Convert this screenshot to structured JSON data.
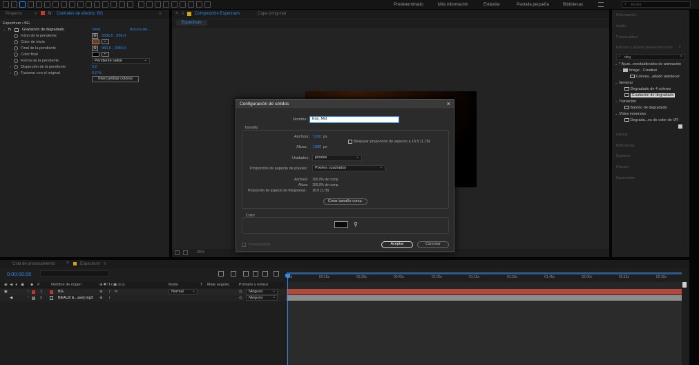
{
  "menubar": {
    "workspaces": [
      "Predeterminado",
      "Más información",
      "Estándar",
      "Pantalla pequeña",
      "Bibliotecas"
    ],
    "search_placeholder": "Ayuda"
  },
  "left_panel": {
    "tabs": [
      "Proyecto",
      "Controles de efectos: BG"
    ],
    "header": "Espectrum • BG",
    "effect_name": "Gradación de degradado",
    "reset_label": "Rest",
    "about_label": "Acerca de...",
    "properties": [
      {
        "label": "Inicio de la pendiente",
        "value": "3332,0 , 856,0"
      },
      {
        "label": "Color de inicio",
        "value": ""
      },
      {
        "label": "Final de la pendiente",
        "value": "960,0 , 1080,0"
      },
      {
        "label": "Color final",
        "value": ""
      },
      {
        "label": "Forma de la pendiente",
        "value": "Pendiente radial"
      },
      {
        "label": "Dispersión de la pendiente",
        "value": "0,0"
      },
      {
        "label": "Fusionar con el original",
        "value": "0,0 %"
      }
    ],
    "swap_button": "Intercambiar colores"
  },
  "composition": {
    "tabs": [
      "Composición Espectrum",
      "Capa (ninguna)"
    ],
    "subtab": "Espectrum",
    "zoom": "25%"
  },
  "dialog": {
    "title": "Configuración de sólidos",
    "name_label": "Nombre:",
    "name_value": "Esp_Mid",
    "size_section": "Tamaño",
    "width_label": "Anchura:",
    "width_value": "1920",
    "width_unit": "px",
    "height_label": "Altura:",
    "height_value": "1080",
    "height_unit": "px",
    "lock_label": "Bloquear proporción de aspecto a 16:9 (1,78)",
    "units_label": "Unidades:",
    "units_value": "píxeles",
    "pixel_aspect_label": "Proporción de aspecto de píxeles:",
    "pixel_aspect_value": "Píxeles cuadrados",
    "info_width_label": "Anchura:",
    "info_width_value": "100,0% de comp.",
    "info_height_label": "Altura:",
    "info_height_value": "100,0% de comp.",
    "info_frame_label": "Proporción de aspecto de fotogramas:",
    "info_frame_value": "16:9 (1,78)",
    "make_comp_size": "Crear tamaño comp.",
    "color_section": "Color",
    "swatch_color": "#0a0a0a",
    "preview_label": "Previsualizar",
    "ok_button": "Aceptar",
    "cancel_button": "Cancelar"
  },
  "right_panel": {
    "items": [
      "Información",
      "Audio",
      "Previsualizar",
      "Efectos y ajustes preestablecidos"
    ],
    "search_value": "deg",
    "tree": [
      {
        "label": "* Ajust...reestablecidos de animación",
        "indent": 0
      },
      {
        "label": "Image - Creative",
        "indent": 1
      },
      {
        "label": "Colores...adado atardecer",
        "indent": 2
      },
      {
        "label": "Generar",
        "indent": 0
      },
      {
        "label": "Degradado de 4 colores",
        "indent": 2
      },
      {
        "label": "Gradación de degradado",
        "indent": 2,
        "selected": true
      },
      {
        "label": "Transición",
        "indent": 0
      },
      {
        "label": "Barrido de degradado",
        "indent": 2
      },
      {
        "label": "Vídeo inmersivo",
        "indent": 0
      },
      {
        "label": "Degrada...es de color de VR",
        "indent": 2
      }
    ],
    "bottom_items": [
      "Alinear",
      "Bibliotecas",
      "Carácter",
      "Párrafo",
      "Rastreador"
    ]
  },
  "timeline": {
    "tabs": [
      "Cola de procesamiento",
      "Espectrum"
    ],
    "timecode": "0:00:00:00",
    "columns": [
      "Nombre de origen",
      "Modo",
      "T",
      "Mate seguim.",
      "Primario y enlace"
    ],
    "layers": [
      {
        "num": "1",
        "name": "BG",
        "mode": "Normal",
        "parent": "Ninguno",
        "color": "#c0392b"
      },
      {
        "num": "2",
        "name": "BEAUZ &...ase].mp3",
        "mode": "",
        "parent": "Ninguno",
        "color": "#7a7a7a"
      }
    ],
    "ruler": [
      "0s",
      "00:15s",
      "00:30s",
      "00:45s",
      "01:00s",
      "01:15s",
      "01:30s",
      "01:45s",
      "02:00s",
      "02:15s",
      "02:30s"
    ],
    "track_colors": [
      "#b04a3d",
      "#8c8c8c"
    ]
  }
}
